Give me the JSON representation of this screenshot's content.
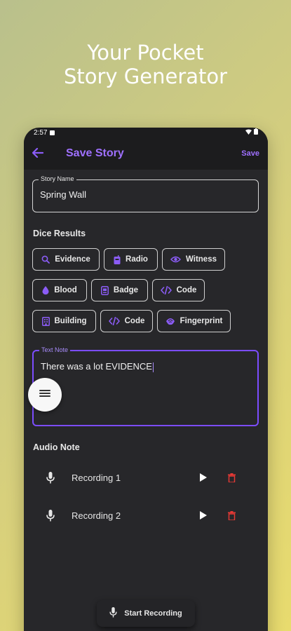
{
  "hero": {
    "line1": "Your Pocket",
    "line2": "Story Generator"
  },
  "status": {
    "time": "2:57"
  },
  "appbar": {
    "title": "Save Story",
    "save_label": "Save"
  },
  "story_name": {
    "label": "Story Name",
    "value": "Spring Wall"
  },
  "dice": {
    "title": "Dice Results",
    "chips": [
      {
        "label": "Evidence",
        "icon": "search-icon"
      },
      {
        "label": "Radio",
        "icon": "radio-icon"
      },
      {
        "label": "Witness",
        "icon": "eye-icon"
      },
      {
        "label": "Blood",
        "icon": "drop-icon"
      },
      {
        "label": "Badge",
        "icon": "badge-icon"
      },
      {
        "label": "Code",
        "icon": "code-icon"
      },
      {
        "label": "Building",
        "icon": "building-icon"
      },
      {
        "label": "Code",
        "icon": "code-icon"
      },
      {
        "label": "Fingerprint",
        "icon": "fingerprint-icon"
      }
    ]
  },
  "text_note": {
    "label": "Text Note",
    "value": "There was a lot EVIDENCE"
  },
  "audio": {
    "title": "Audio Note",
    "recordings": [
      {
        "label": "Recording 1"
      },
      {
        "label": "Recording 2"
      }
    ],
    "start_label": "Start Recording"
  },
  "colors": {
    "accent": "#8b5cf6",
    "delete": "#e53935",
    "surface": "#27272a"
  }
}
